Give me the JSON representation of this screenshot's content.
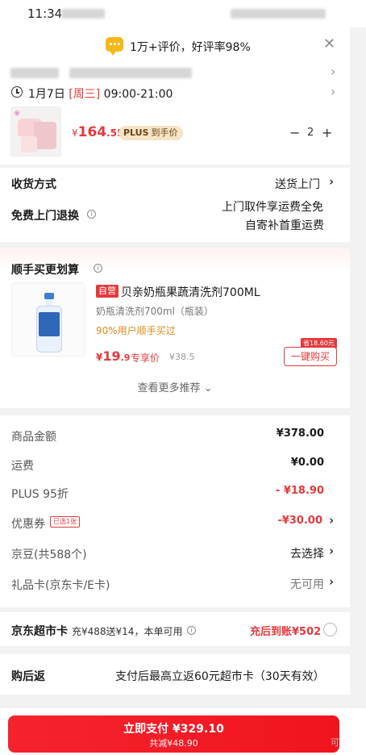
{
  "status_bar": {
    "time": "11:34"
  },
  "toast": {
    "text": "1万+评价，好评率98%",
    "close_icon": "close-icon"
  },
  "delivery": {
    "date": "1月7日",
    "weekday": "[周三]",
    "hours": "09:00-21:00"
  },
  "product": {
    "price_currency": "¥",
    "price_integer": "164",
    "price_decimal": ".55",
    "plus_label": "PLUS",
    "plus_text": "到手价",
    "qty_minus": "−",
    "quantity": "2",
    "qty_plus": "+"
  },
  "shipping": {
    "method_label": "收货方式",
    "method_value": "送货上门",
    "return_label": "免费上门退换",
    "return_line1": "上门取件享运费全免",
    "return_line2": "自寄补首重运费"
  },
  "recommend": {
    "title": "顺手买更划算",
    "self_tag": "自营",
    "name": "贝亲奶瓶果蔬清洗剂700ML",
    "spec": "奶瓶清洗剂700ml（瓶装）",
    "buyers": "90%用户顺手买过",
    "price_currency": "¥",
    "price_integer": "19",
    "price_decimal": ".9",
    "price_tag": "专享价",
    "original_price": "¥38.5",
    "save_tag": "省18.60元",
    "buy_button": "一键购买",
    "more": "查看更多推荐"
  },
  "summary": {
    "goods_label": "商品金额",
    "goods_value": "¥378.00",
    "freight_label": "运费",
    "freight_value": "¥0.00",
    "plus_label": "PLUS 95折",
    "plus_value": "- ¥18.90",
    "coupon_label": "优惠券",
    "coupon_tag": "已选1张",
    "coupon_value": "-¥30.00",
    "bean_label": "京豆(共588个)",
    "bean_value": "去选择",
    "gift_label": "礼品卡(京东卡/E卡)",
    "gift_value": "无可用"
  },
  "market_card": {
    "title": "京东超市卡",
    "desc": "充¥488送¥14，本单可用",
    "action": "充后到账¥502"
  },
  "cashback": {
    "label": "购后返",
    "text": "支付后最高立返60元超市卡（30天有效）"
  },
  "pay": {
    "main": "立即支付 ¥329.10",
    "sub": "共减¥48.90",
    "side_hint": "可"
  },
  "colors": {
    "accent": "#e4393c",
    "pay_button": "#f5232e",
    "plus_badge": "#f7e3c6"
  }
}
